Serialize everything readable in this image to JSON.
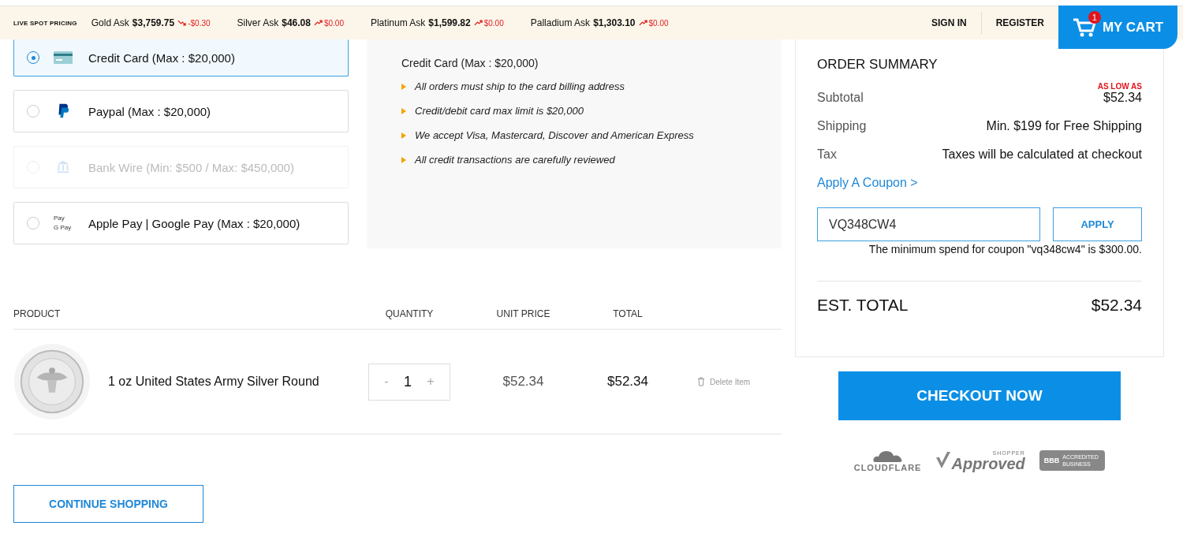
{
  "ticker": {
    "label": "LIVE SPOT PRICING",
    "items": [
      {
        "metal": "Gold Ask",
        "price": "$3,759.75",
        "change": "-$0.30",
        "rising": false
      },
      {
        "metal": "Silver Ask",
        "price": "$46.08",
        "change": "$0.00",
        "rising": true
      },
      {
        "metal": "Platinum Ask",
        "price": "$1,599.82",
        "change": "$0.00",
        "rising": true
      },
      {
        "metal": "Palladium Ask",
        "price": "$1,303.10",
        "change": "$0.00",
        "rising": true
      }
    ]
  },
  "nav": [
    "SIGN IN",
    "REGISTER"
  ],
  "cart": {
    "label": "MY CART",
    "count": "1"
  },
  "payment_methods": [
    {
      "kind": "card",
      "label": "Credit Card (Max : $20,000)",
      "selected": true,
      "disabled": false
    },
    {
      "kind": "paypal",
      "label": "Paypal (Max : $20,000)",
      "selected": false,
      "disabled": false
    },
    {
      "kind": "bank",
      "label": "Bank Wire (Min: $500 / Max: $450,000)",
      "selected": false,
      "disabled": true
    },
    {
      "kind": "wallet",
      "label": "Apple Pay | Google Pay (Max : $20,000)",
      "selected": false,
      "disabled": false,
      "icon_lines": [
        "Pay",
        "G Pay"
      ]
    }
  ],
  "payment_info": {
    "title": "Credit Card (Max : $20,000)",
    "notes": [
      "All orders must ship to the card billing address",
      "Credit/debit card max limit is $20,000",
      "We accept Visa, Mastercard, Discover and American Express",
      "All credit transactions are carefully reviewed"
    ]
  },
  "cart_table": {
    "columns": [
      "PRODUCT",
      "QUANTITY",
      "UNIT PRICE",
      "TOTAL"
    ],
    "rows": [
      {
        "product": "1 oz United States Army Silver Round",
        "quantity": "1",
        "decrement": "-",
        "increment": "+",
        "unit_price": "$52.34",
        "total": "$52.34",
        "delete": "Delete Item"
      }
    ]
  },
  "continue_button": "CONTINUE SHOPPING",
  "order_summary": {
    "title": "ORDER SUMMARY",
    "subtotal_label": "Subtotal",
    "subtotal_note": "AS LOW AS",
    "subtotal": "$52.34",
    "shipping_label": "Shipping",
    "shipping": "Min. $199 for Free Shipping",
    "tax_label": "Tax",
    "tax": "Taxes will be calculated at checkout",
    "coupon_link": "Apply A Coupon >",
    "coupon_value": "VQ348CW4",
    "coupon_button": "APPLY",
    "coupon_error": "The minimum spend for coupon \"vq348cw4\" is $300.00.",
    "total_label": "EST. TOTAL",
    "total": "$52.34"
  },
  "checkout_button": "CHECKOUT NOW",
  "trust_badges": {
    "cloudflare": "CLOUDFLARE",
    "shopper_top": "SHOPPER",
    "shopper": "Approved",
    "bbb": "BBB",
    "bbb_text": "ACCREDITED BUSINESS"
  }
}
